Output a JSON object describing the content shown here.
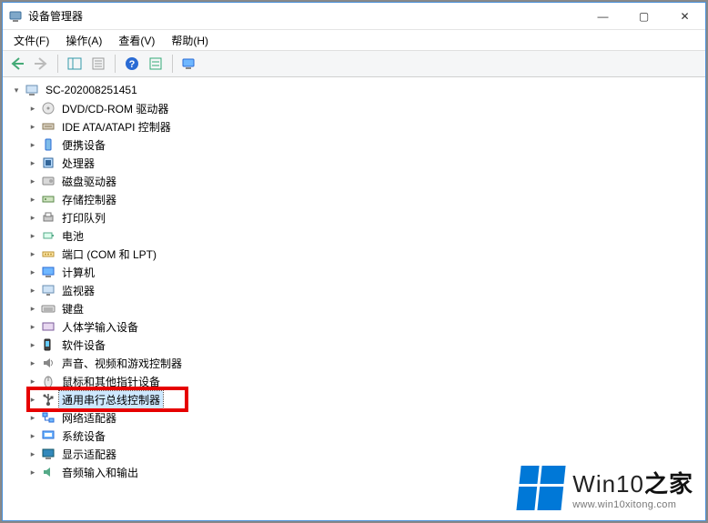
{
  "window": {
    "title": "设备管理器"
  },
  "window_controls": {
    "minimize": "—",
    "maximize": "▢",
    "close": "✕"
  },
  "menu": {
    "file": "文件(F)",
    "action": "操作(A)",
    "view": "查看(V)",
    "help": "帮助(H)"
  },
  "tree": {
    "root": "SC-202008251451",
    "items": [
      {
        "label": "DVD/CD-ROM 驱动器",
        "icon": "disc"
      },
      {
        "label": "IDE ATA/ATAPI 控制器",
        "icon": "ide"
      },
      {
        "label": "便携设备",
        "icon": "portable"
      },
      {
        "label": "处理器",
        "icon": "cpu"
      },
      {
        "label": "磁盘驱动器",
        "icon": "disk"
      },
      {
        "label": "存储控制器",
        "icon": "storage"
      },
      {
        "label": "打印队列",
        "icon": "printer"
      },
      {
        "label": "电池",
        "icon": "battery"
      },
      {
        "label": "端口 (COM 和 LPT)",
        "icon": "port"
      },
      {
        "label": "计算机",
        "icon": "computer"
      },
      {
        "label": "监视器",
        "icon": "monitor"
      },
      {
        "label": "键盘",
        "icon": "keyboard"
      },
      {
        "label": "人体学输入设备",
        "icon": "hid"
      },
      {
        "label": "软件设备",
        "icon": "software"
      },
      {
        "label": "声音、视频和游戏控制器",
        "icon": "sound"
      },
      {
        "label": "鼠标和其他指针设备",
        "icon": "mouse"
      },
      {
        "label": "通用串行总线控制器",
        "icon": "usb",
        "selected": true,
        "highlight": true
      },
      {
        "label": "网络适配器",
        "icon": "network"
      },
      {
        "label": "系统设备",
        "icon": "system"
      },
      {
        "label": "显示适配器",
        "icon": "display"
      },
      {
        "label": "音频输入和输出",
        "icon": "audio"
      }
    ]
  },
  "watermark": {
    "brand_prefix": "Win10",
    "brand_suffix": "之家",
    "url": "www.win10xitong.com"
  },
  "glyphs": {
    "expander_open": "▾",
    "expander_closed": "▸"
  }
}
